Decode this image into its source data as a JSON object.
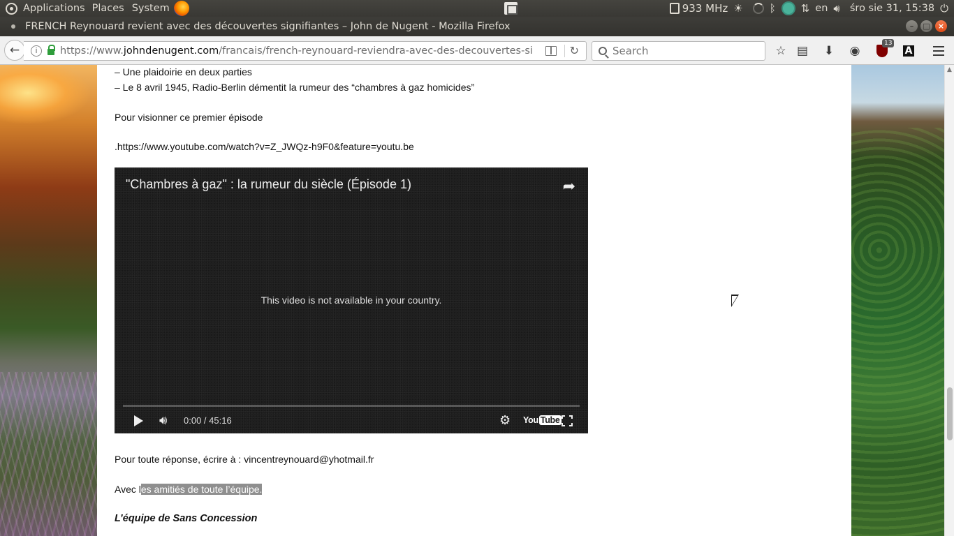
{
  "panel": {
    "applications": "Applications",
    "places": "Places",
    "system": "System",
    "cpu_freq": "933 MHz",
    "keyboard_layout": "en",
    "clock": "śro sie 31, 15:38"
  },
  "window": {
    "title": "FRENCH Reynouard revient avec des découvertes signifiantes – John de Nugent - Mozilla Firefox"
  },
  "navbar": {
    "url_prefix": "https://www.",
    "url_host": "johndenugent.com",
    "url_path": "/francais/french-reynouard-reviendra-avec-des-decouvertes-signifiantes",
    "search_placeholder": "Search",
    "ublock_count": "13"
  },
  "article": {
    "line1": "– Une plaidoirie en deux parties",
    "line2": "– Le 8 avril 1945, Radio-Berlin démentit la rumeur des “chambres à gaz homicides”",
    "line3": "Pour visionner ce premier épisode",
    "line4": ".https://www.youtube.com/watch?v=Z_JWQz-h9F0&feature=youtu.be",
    "contact": "Pour toute réponse, écrire à : vincentreynouard@yhotmail.fr",
    "regards_prefix": "Avec l",
    "regards_selected": "es amitiés de toute l’équipe.",
    "signature": "L’équipe de Sans Concession"
  },
  "video": {
    "title": "\"Chambres à gaz\" : la rumeur du siècle (Épisode 1)",
    "message": "This video is not available in your country.",
    "time": "0:00 / 45:16",
    "logo_you": "You",
    "logo_tube": "Tube",
    "progress": 0
  },
  "colors": {
    "firefox_toolbar": "#f0f0f0",
    "panel_bg": "#3c3b37",
    "close_button": "#df4a16",
    "selection_highlight": "#8f8f8f"
  }
}
